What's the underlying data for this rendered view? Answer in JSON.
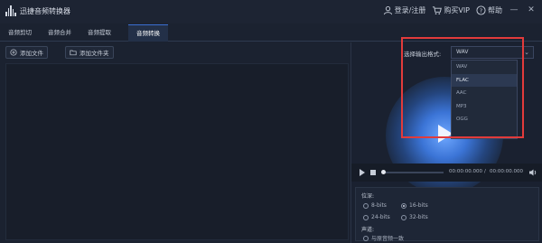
{
  "app": {
    "title": "迅捷音频转换器"
  },
  "titlebar": {
    "login_label": "登录/注册",
    "vip_label": "购买VIP",
    "help_label": "帮助"
  },
  "tabs": [
    {
      "label": "音频剪切"
    },
    {
      "label": "音频合并"
    },
    {
      "label": "音频提取"
    },
    {
      "label": "音频转换",
      "active": true
    }
  ],
  "toolbar": {
    "add_file_label": "添加文件",
    "add_folder_label": "添加文件夹"
  },
  "output": {
    "format_label": "选择输出格式:",
    "selected": "WAV",
    "options": [
      "WAV",
      "FLAC",
      "AAC",
      "MP3",
      "OGG"
    ],
    "highlighted": "FLAC"
  },
  "player": {
    "current_time": "00:00:00.000",
    "separator": "/",
    "total_time": "00:00:00.000",
    "progress": 0
  },
  "settings": {
    "bitdepth_label": "位深:",
    "bitdepth_options": [
      "8-bits",
      "16-bits",
      "24-bits",
      "32-bits"
    ],
    "bitdepth_selected": "16-bits",
    "channel_label": "声道:",
    "channel_first_option": "与原音频一致"
  },
  "colors": {
    "highlight_box": "#e23b3b",
    "accent": "#3a6fd1",
    "background": "#1b2230"
  }
}
